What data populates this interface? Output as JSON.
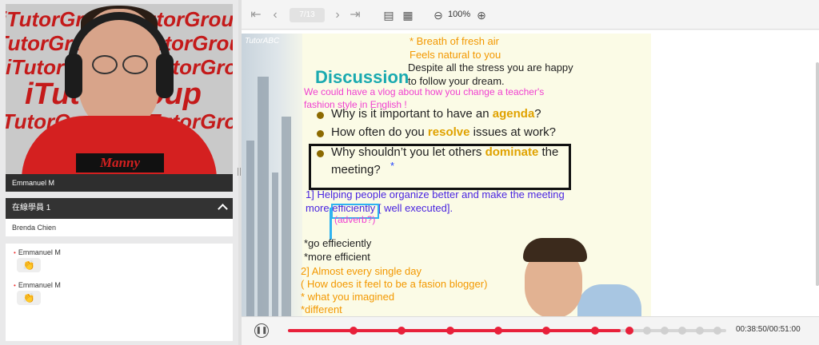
{
  "video": {
    "watermark": "iTutorGroup",
    "nameplate": "Manny",
    "presenter_name": "Emmanuel M"
  },
  "online": {
    "header": "在線學員 1",
    "students": [
      "Brenda Chien"
    ]
  },
  "chat": {
    "messages": [
      {
        "sender": "Emmanuel M",
        "content": "👏"
      },
      {
        "sender": "Emmanuel M",
        "content": "👏"
      }
    ]
  },
  "toolbar": {
    "page_indicator": "7/13",
    "zoom": "100%",
    "icons": [
      "first-page-icon",
      "prev-page-icon",
      "next-page-icon",
      "last-page-icon",
      "document-icon",
      "document-list-icon",
      "zoom-out-icon",
      "zoom-in-icon"
    ]
  },
  "slide": {
    "brand": "TutorABC",
    "title": "Discussion",
    "questions": [
      {
        "before": "Why is it important to have an ",
        "highlight": "agenda",
        "after": "?"
      },
      {
        "before": "How often do you ",
        "highlight": "resolve",
        "after": " issues at work?"
      },
      {
        "before": "Why shouldn’t you let others ",
        "highlight": "dominate",
        "after": " the"
      }
    ],
    "q3_line2": "meeting?",
    "annotations": {
      "breath": "* Breath of fresh air",
      "feels": "Feels natural to you",
      "despite_1": "Despite all the stress you are happy",
      "despite_2": "to follow your dream.",
      "vlog_1": "We could have a vlog about how you change a teacher's",
      "vlog_2": "fashion style in English !",
      "star": "*",
      "helping_1": "1] Helping people organize better and make the meeting",
      "helping_2a": "more",
      "helping_2b": "efficiently",
      "helping_2c": "[ well executed].",
      "adverb": "(adverb?)",
      "go": "*go effieciently",
      "more_eff": "*more efficient",
      "almost": "2] Almost every single day",
      "fasion": "( How does it feel to be a fasion blogger)",
      "what": "* what you imagined",
      "different": "*different"
    }
  },
  "player": {
    "time": "00:38:50/00:51:00",
    "progress": 0.76,
    "markers": [
      0.15,
      0.26,
      0.37,
      0.48,
      0.59,
      0.7,
      0.78,
      0.82,
      0.86,
      0.9,
      0.94,
      0.98
    ]
  },
  "colors": {
    "accent_red": "#e8203a",
    "teal_title": "#1aaab0",
    "highlight": "#e0a200",
    "annotation_orange": "#f39800",
    "annotation_pink": "#f040d0",
    "annotation_purple": "#4a25e0"
  }
}
